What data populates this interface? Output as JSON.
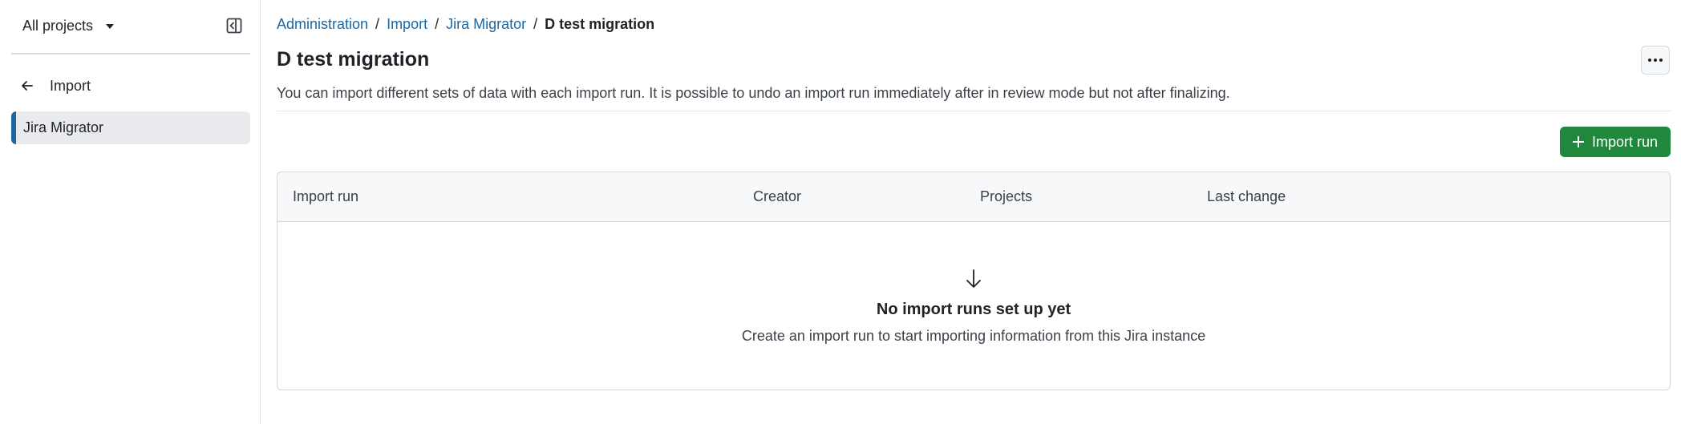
{
  "sidebar": {
    "project_switcher": "All projects",
    "back_label": "Import",
    "items": [
      {
        "label": "Jira Migrator",
        "active": true
      }
    ]
  },
  "breadcrumb": {
    "items": [
      "Administration",
      "Import",
      "Jira Migrator"
    ],
    "current": "D test migration",
    "separator": "/"
  },
  "page": {
    "title": "D test migration",
    "description": "You can import different sets of data with each import run. It is possible to undo an import run immediately after in review mode but not after finalizing."
  },
  "actions": {
    "primary_label": "Import run"
  },
  "table": {
    "columns": [
      "Import run",
      "Creator",
      "Projects",
      "Last change"
    ],
    "empty_title": "No import runs set up yet",
    "empty_description": "Create an import run to start importing information from this Jira instance"
  },
  "icons": {
    "caret": "triangle-down-icon",
    "collapse": "sidebar-collapse-icon",
    "back": "arrow-left-icon",
    "more": "kebab-horizontal-icon",
    "plus": "plus-icon",
    "empty": "arrow-down-icon"
  },
  "colors": {
    "link": "#1a67a3",
    "primary_button": "#1f883d",
    "active_accent": "#1a67a3"
  }
}
